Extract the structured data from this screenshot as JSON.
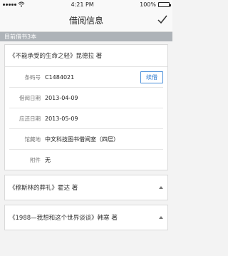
{
  "status_bar": {
    "time": "4:21 PM",
    "battery": "100%"
  },
  "nav": {
    "title": "借阅信息"
  },
  "section": {
    "header": "目前借书3本"
  },
  "books": [
    {
      "title": "《不能承受的生命之轻》昆德拉 著",
      "expanded": true,
      "details": [
        {
          "label": "条码号",
          "value": "C1484021"
        },
        {
          "label": "借阅日期",
          "value": "2013-04-09"
        },
        {
          "label": "应还日期",
          "value": "2013-05-09"
        },
        {
          "label": "馆藏地",
          "value": "中文科技图书借阅室（四层）"
        },
        {
          "label": "附件",
          "value": "无"
        }
      ],
      "renew_label": "续借"
    },
    {
      "title": "《穆斯林的葬礼》霍达 著",
      "expanded": false
    },
    {
      "title": "《1988—我想和这个世界谈谈》韩寒 著",
      "expanded": false
    }
  ]
}
